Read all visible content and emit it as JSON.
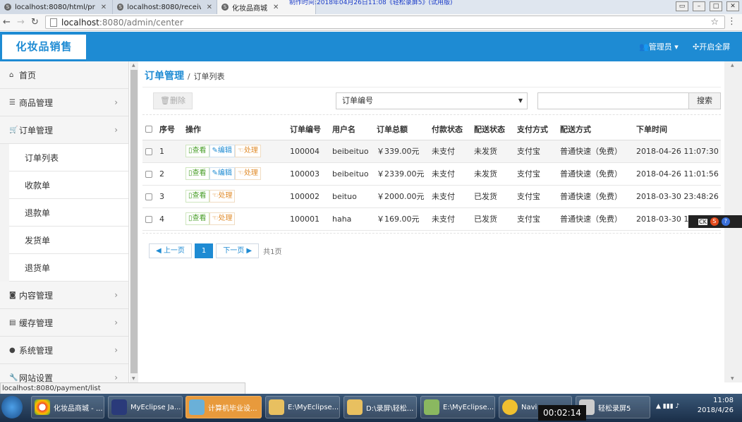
{
  "browser": {
    "tabs": [
      {
        "label": "localhost:8080/html/pr"
      },
      {
        "label": "localhost:8080/receive"
      },
      {
        "label": "化妆品商城"
      }
    ],
    "recorder_overlay": "制作时间:2018年04月26日11:08《轻松录屏5》(试用版)",
    "url_host": "localhost",
    "url_path": ":8080/admin/center"
  },
  "header": {
    "logo": "化妆品销售",
    "admin_label": "管理员",
    "fullscreen_label": "开启全屏"
  },
  "sidebar": {
    "items": [
      {
        "label": "首页",
        "icon": "home-icon"
      },
      {
        "label": "商品管理",
        "icon": "list-icon"
      },
      {
        "label": "订单管理",
        "icon": "cart-icon"
      },
      {
        "label": "内容管理",
        "icon": "rss-icon"
      },
      {
        "label": "缓存管理",
        "icon": "file-icon"
      },
      {
        "label": "系统管理",
        "icon": "user-icon"
      },
      {
        "label": "网站设置",
        "icon": "wrench-icon"
      }
    ],
    "submenu": [
      "订单列表",
      "收款单",
      "退款单",
      "发货单",
      "退货单"
    ]
  },
  "main": {
    "breadcrumb_title": "订单管理",
    "breadcrumb_sep": "/",
    "breadcrumb_current": "订单列表",
    "delete_label": "删除",
    "search_field_selected": "订单编号",
    "search_value": "",
    "search_button": "搜索",
    "columns": [
      "序号",
      "操作",
      "订单编号",
      "用户名",
      "订单总额",
      "付款状态",
      "配送状态",
      "支付方式",
      "配送方式",
      "下单时间"
    ],
    "action_labels": {
      "view": "查看",
      "edit": "编辑",
      "process": "处理"
    },
    "rows": [
      {
        "idx": "1",
        "order_no": "100004",
        "user": "beibeituo",
        "total": "￥339.00元",
        "pay": "未支付",
        "ship": "未发货",
        "method": "支付宝",
        "delivery": "普通快速（免费）",
        "time": "2018-04-26 11:07:30",
        "editable": true
      },
      {
        "idx": "2",
        "order_no": "100003",
        "user": "beibeituo",
        "total": "￥2339.00元",
        "pay": "未支付",
        "ship": "未发货",
        "method": "支付宝",
        "delivery": "普通快速（免费）",
        "time": "2018-04-26 11:01:56",
        "editable": true
      },
      {
        "idx": "3",
        "order_no": "100002",
        "user": "beituo",
        "total": "￥2000.00元",
        "pay": "未支付",
        "ship": "已发货",
        "method": "支付宝",
        "delivery": "普通快速（免费）",
        "time": "2018-03-30 23:48:26",
        "editable": false
      },
      {
        "idx": "4",
        "order_no": "100001",
        "user": "haha",
        "total": "￥169.00元",
        "pay": "未支付",
        "ship": "已发货",
        "method": "支付宝",
        "delivery": "普通快速（免费）",
        "time": "2018-03-30 14",
        "editable": false
      }
    ],
    "pager": {
      "prev": "上一页",
      "current": "1",
      "next": "下一页",
      "total": "共1页"
    }
  },
  "status_url": "localhost:8080/payment/list",
  "ime": {
    "ck": "CK",
    "s": "S",
    "q": "?"
  },
  "taskbar": {
    "items": [
      "化妆品商城 - ...",
      "MyEclipse Ja...",
      "计算机毕业设...",
      "E:\\MyEclipse...",
      "D:\\录屏\\轻松...",
      "E:\\MyEclipse...",
      "Navi",
      "轻松录屏5"
    ],
    "timer": "00:02:14",
    "clock_time": "11:08",
    "clock_date": "2018/4/26"
  },
  "colors": {
    "accent": "#1e8bd3",
    "view": "#4a9f2a",
    "process": "#e08b2a"
  }
}
